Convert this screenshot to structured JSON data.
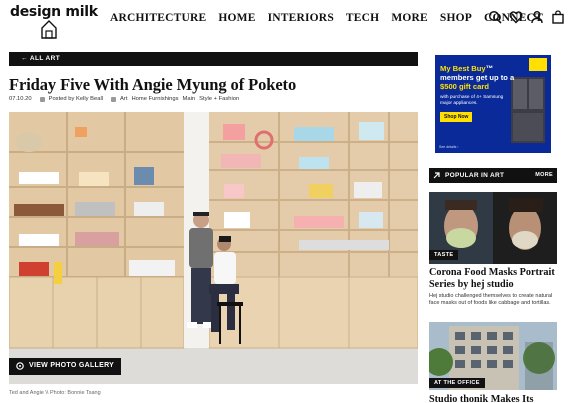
{
  "brand": {
    "logo_text": "design milk"
  },
  "nav": {
    "items": [
      {
        "label": "ARCHITECTURE"
      },
      {
        "label": "HOME"
      },
      {
        "label": "INTERIORS"
      },
      {
        "label": "TECH"
      },
      {
        "label": "MORE"
      },
      {
        "label": "SHOP"
      },
      {
        "label": "CONNECT"
      }
    ],
    "icons": [
      "search-icon",
      "heart-icon",
      "user-icon",
      "bag-icon"
    ]
  },
  "category_bar": {
    "label": "← ALL ART"
  },
  "article": {
    "title": "Friday Five With Angie Myung of Poketo",
    "date": "07.10.20",
    "author": "Posted by Kelly Beall",
    "tags": [
      "Art",
      "Home Furnishings",
      "Main",
      "Style + Fashion"
    ],
    "gallery_button": "VIEW PHOTO GALLERY",
    "caption": "Ted and Angie \\\\ Photo: Bonnie Tsang"
  },
  "sidebar": {
    "ad": {
      "headline_brand": "My Best Buy",
      "headline_rest": "™ members get up to a",
      "headline_amount": "$500 gift card",
      "subtext": "with purchase of 4+ Samsung major appliances.",
      "cta": "Shop Now",
      "fine_print": "See details ›"
    },
    "popular": {
      "label": "POPULAR IN ART",
      "more": "MORE"
    },
    "posts": [
      {
        "tag": "TASTE",
        "title": "Corona Food Masks Portrait Series by hej studio",
        "desc": "Hej studio challenged themselves to create natural face masks out of foods like cabbage and tortillas."
      },
      {
        "tag": "AT THE OFFICE",
        "title": "Studio thonik Makes Its"
      }
    ]
  },
  "colors": {
    "black": "#111111",
    "ad_blue": "#0a2a9a",
    "ad_yellow": "#ffe000"
  }
}
